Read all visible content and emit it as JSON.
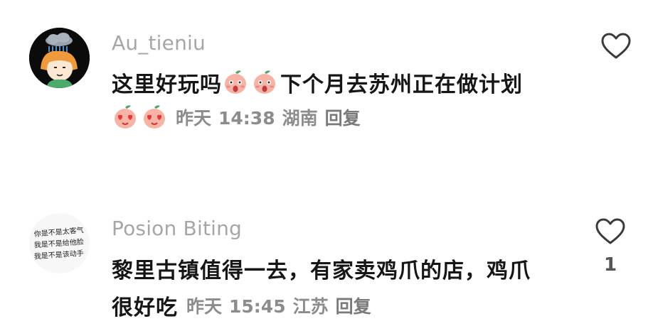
{
  "comments": [
    {
      "username": "Au_tieniu",
      "text_before_emoji": "这里好玩吗",
      "text_after_emoji": "下个月去苏州正在做计划",
      "inline_emojis": [
        "peach-shocked-emoji",
        "peach-shocked-emoji"
      ],
      "meta_emojis": [
        "peach-heart-eyes-emoji",
        "peach-heart-eyes-emoji"
      ],
      "date": "昨天",
      "time": "14:38",
      "location": "湖南",
      "reply_label": "回复",
      "like_icon": "heart-outline-icon",
      "like_count": ""
    },
    {
      "username": "Posion Biting",
      "line1": "黎里古镇值得一去，有家卖鸡爪的店，鸡爪",
      "line2": "很好吃",
      "date": "昨天",
      "time": "15:45",
      "location": "江苏",
      "reply_label": "回复",
      "like_icon": "heart-outline-icon",
      "like_count": "1",
      "avatar_text": [
        "你是不是太客气",
        "我是不是给他脸",
        "我是不是该动手"
      ]
    }
  ],
  "colors": {
    "username": "#a6a6a6",
    "text": "#161616",
    "meta": "#8c8c8c",
    "icon": "#3a3a3a",
    "peach": "#f6b3a6"
  }
}
